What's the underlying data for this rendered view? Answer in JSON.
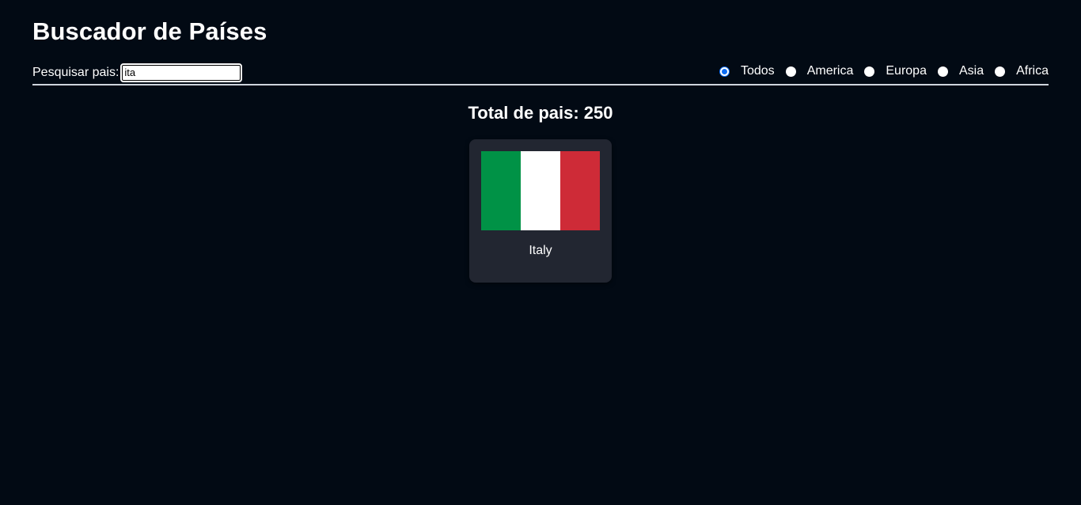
{
  "header": {
    "title": "Buscador de Países"
  },
  "search": {
    "label": "Pesquisar pais:",
    "value": "ita",
    "placeholder": ""
  },
  "filters": {
    "selected": "Todos",
    "options": [
      {
        "label": "Todos",
        "checked": true
      },
      {
        "label": "America",
        "checked": false
      },
      {
        "label": "Europa",
        "checked": false
      },
      {
        "label": "Asia",
        "checked": false
      },
      {
        "label": "Africa",
        "checked": false
      }
    ]
  },
  "summary": {
    "total_text": "Total de pais: 250"
  },
  "results": [
    {
      "name": "Italy",
      "flag_colors": [
        "#009246",
        "#ffffff",
        "#ce2b37"
      ]
    }
  ],
  "colors": {
    "background": "#020a14",
    "card": "#222631",
    "accent": "#0b6cf5"
  }
}
